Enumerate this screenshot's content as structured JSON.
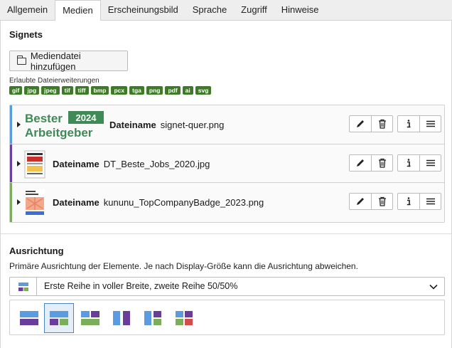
{
  "tabs": [
    "Allgemein",
    "Medien",
    "Erscheinungsbild",
    "Sprache",
    "Zugriff",
    "Hinweise"
  ],
  "active_tab": "Medien",
  "signets": {
    "title": "Signets",
    "add_label": "Mediendatei hinzufügen",
    "allowed_label": "Erlaubte Dateierweiterungen",
    "extensions": [
      "gif",
      "jpg",
      "jpeg",
      "tif",
      "tiff",
      "bmp",
      "pcx",
      "tga",
      "png",
      "pdf",
      "ai",
      "svg"
    ],
    "files": [
      {
        "field_label": "Dateiname",
        "filename": "signet-quer.png",
        "accent": "#5a9be0",
        "logo_line1": "Bester",
        "logo_year": "2024",
        "logo_line2": "Arbeitgeber"
      },
      {
        "field_label": "Dateiname",
        "filename": "DT_Beste_Jobs_2020.jpg",
        "accent": "#6b3fa0"
      },
      {
        "field_label": "Dateiname",
        "filename": "kununu_TopCompanyBadge_2023.png",
        "accent": "#7aab5f"
      }
    ]
  },
  "orientation": {
    "title": "Ausrichtung",
    "description": "Primäre Ausrichtung der Elemente. Je nach Display-Größe kann die Ausrichtung abweichen.",
    "selected_value": "Erste Reihe in voller Breite, zweite Reihe 50/50%",
    "selected_option_index": 1
  },
  "colors": {
    "tag_green": "#3e7b27",
    "layout_blue": "#5b9be2",
    "layout_purple": "#6a3d9a",
    "layout_green": "#7bae5b",
    "layout_red": "#d34b4b"
  }
}
